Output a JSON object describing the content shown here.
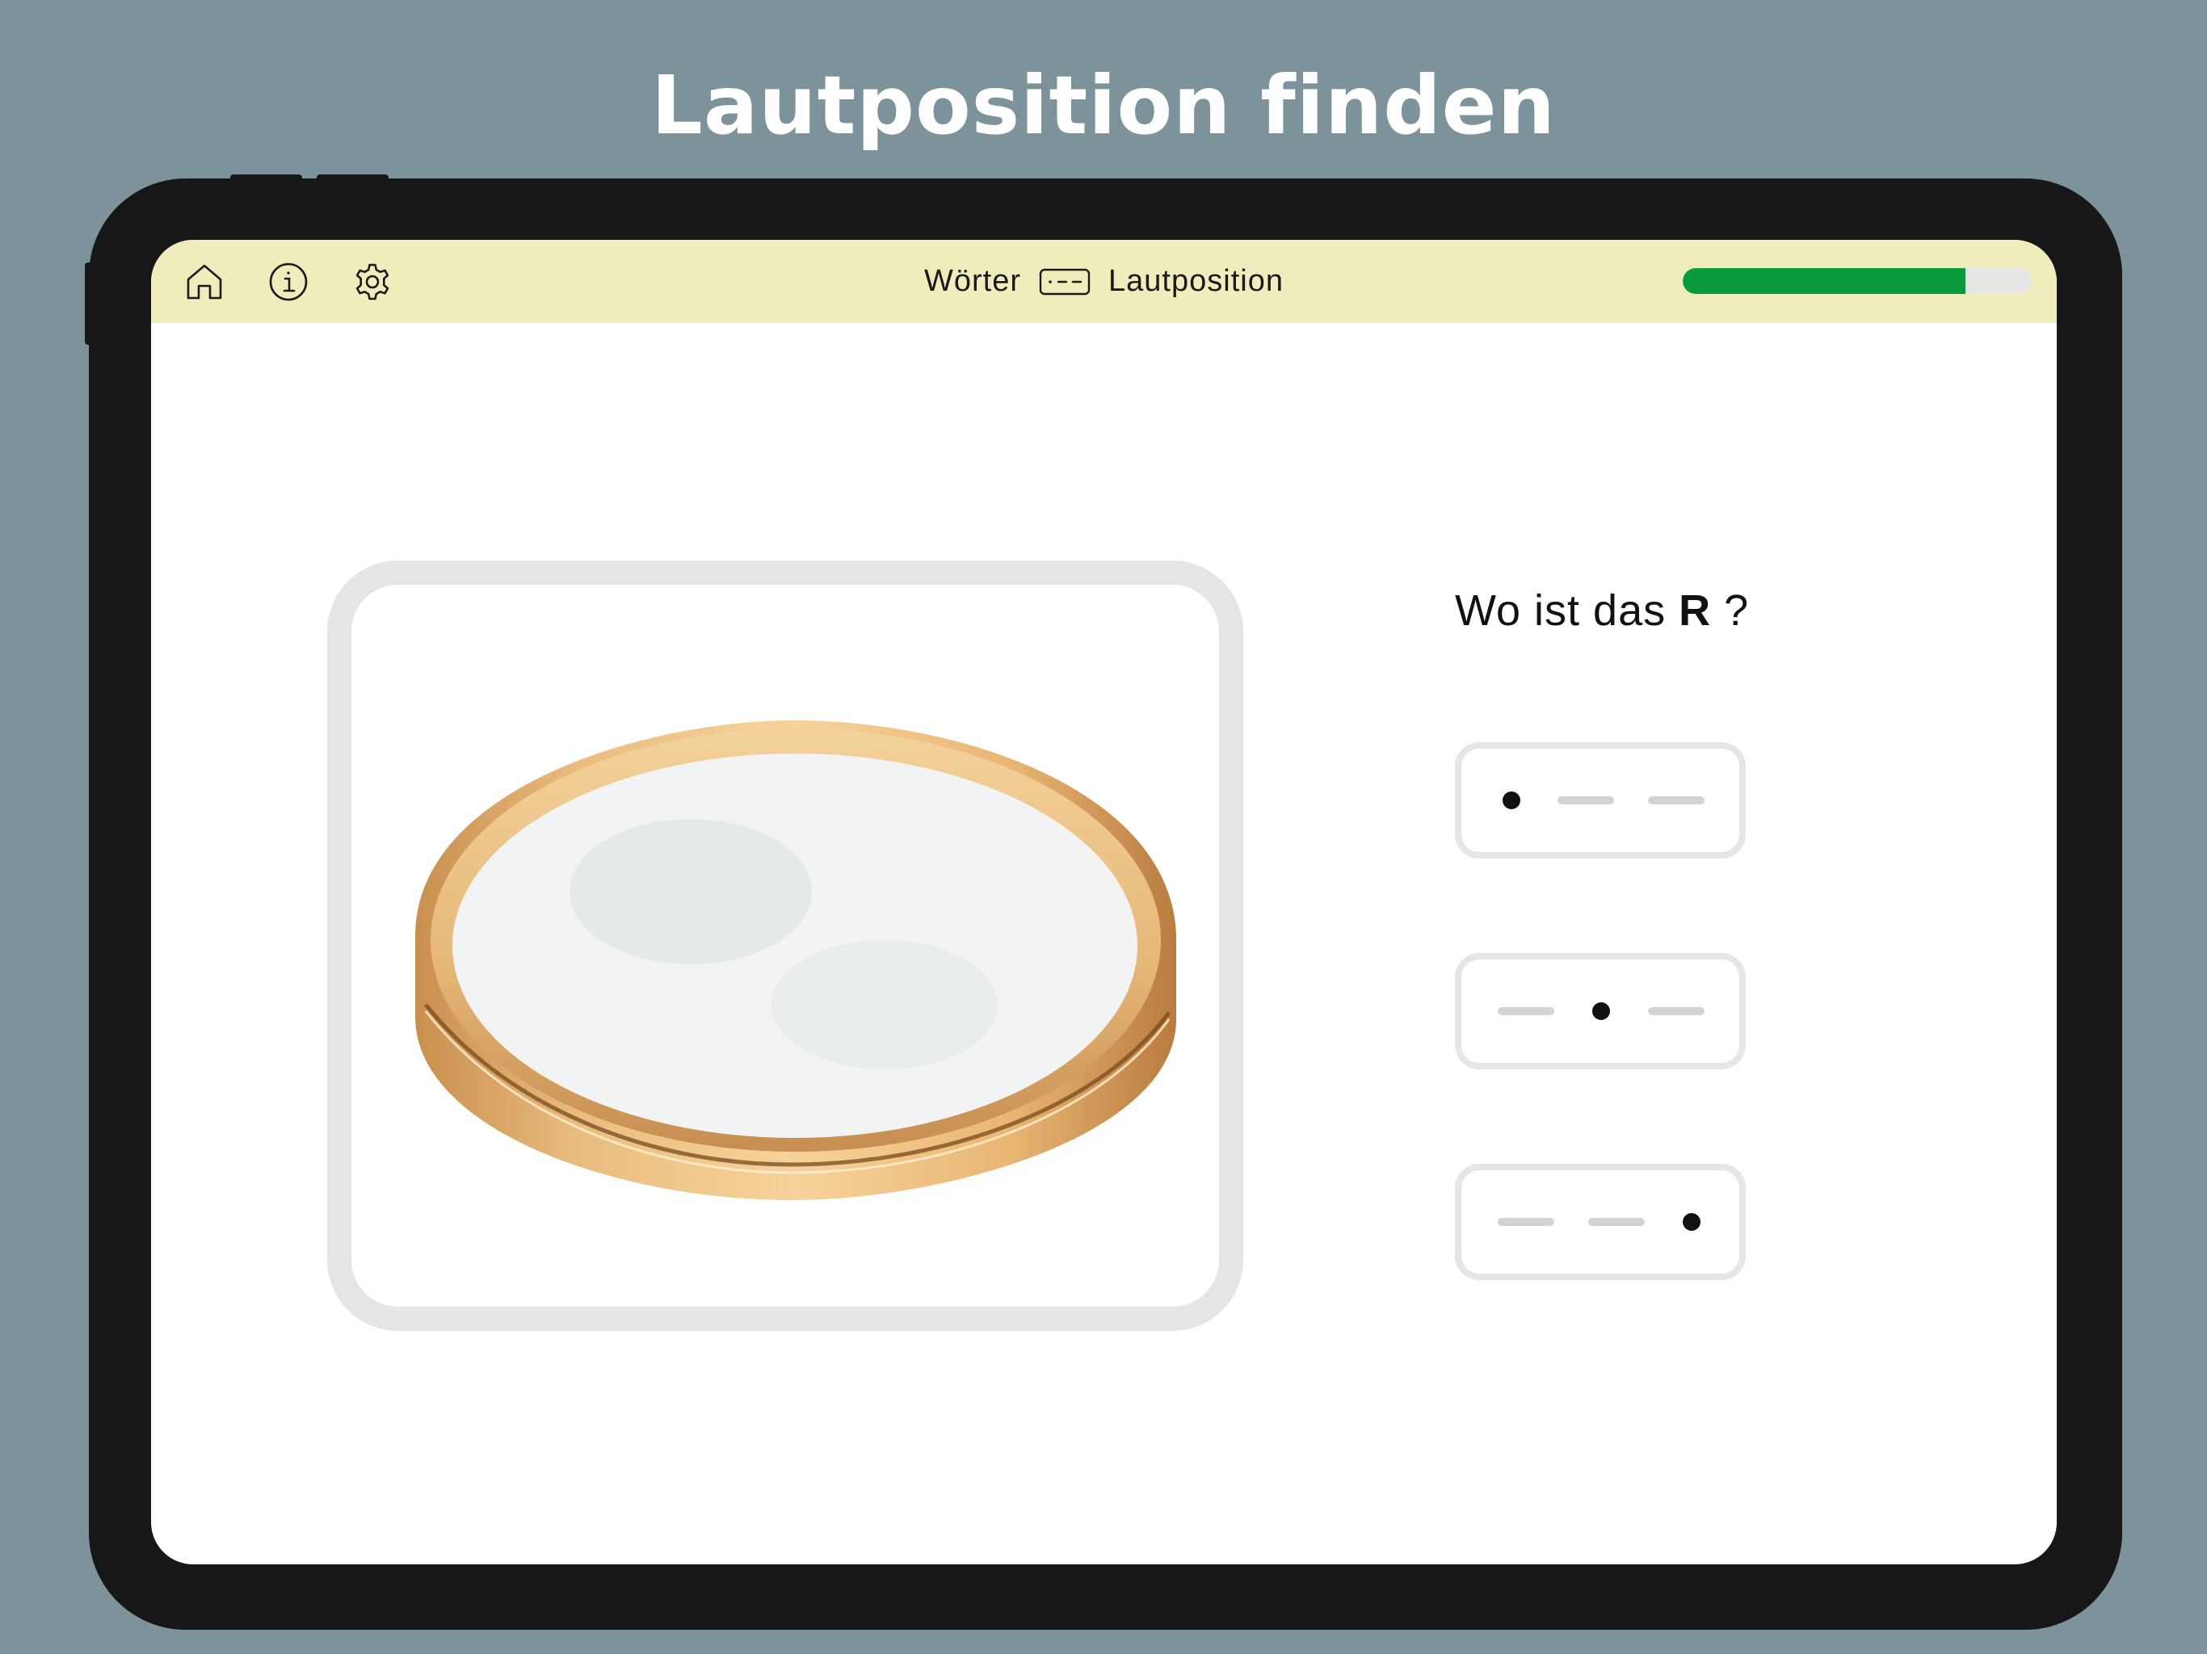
{
  "page": {
    "heading": "Lautposition finden",
    "background_color": "#7c939b"
  },
  "topbar": {
    "background_color": "#eeedbb",
    "icons": [
      "home-icon",
      "info-icon",
      "gear-icon"
    ],
    "breadcrumb": {
      "first": "Wörter",
      "separator_icon": "position-pattern-icon",
      "second": "Lautposition"
    },
    "progress": {
      "value": 0.81,
      "fill_color": "#0a9b3f",
      "track_color": "#e6e6e6"
    }
  },
  "main": {
    "picture": {
      "subject": "gold-ring-photo"
    },
    "question": {
      "prefix": "Wo ist das",
      "target_letter": "R",
      "suffix": " ?"
    },
    "options": [
      {
        "position": "start",
        "icon": "dot-dash-dash-icon"
      },
      {
        "position": "middle",
        "icon": "dash-dot-dash-icon"
      },
      {
        "position": "end",
        "icon": "dash-dash-dot-icon"
      }
    ]
  }
}
